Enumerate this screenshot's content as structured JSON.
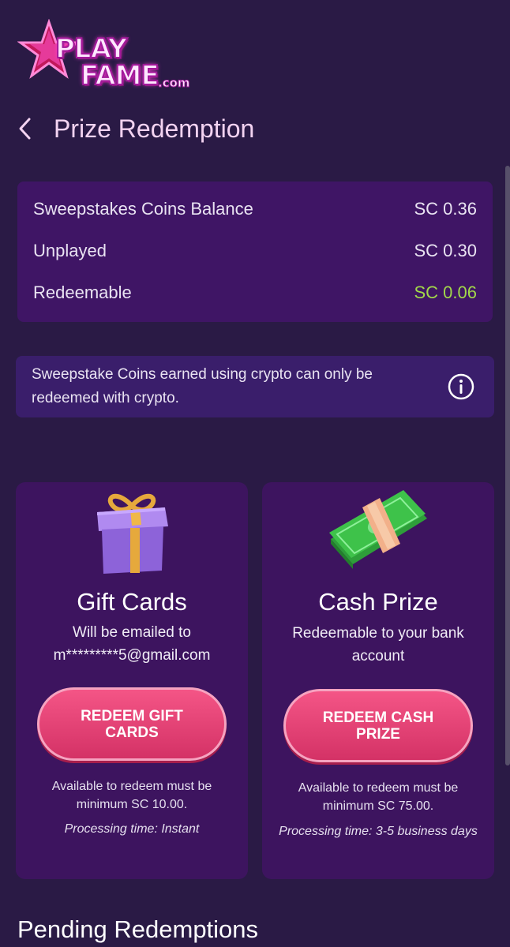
{
  "logo": {
    "line1": "PLAY",
    "line2": "FAME",
    "suffix": ".com"
  },
  "header": {
    "title": "Prize Redemption"
  },
  "balance": {
    "rows": [
      {
        "label": "Sweepstakes Coins Balance",
        "value": "SC 0.36"
      },
      {
        "label": "Unplayed",
        "value": "SC 0.30"
      },
      {
        "label": "Redeemable",
        "value": "SC 0.06"
      }
    ],
    "redeemable_color": "#a2d84a"
  },
  "notice": {
    "text": "Sweepstake Coins earned using crypto can only be redeemed with crypto."
  },
  "gift_cards": {
    "title": "Gift Cards",
    "sub_line1": "Will be emailed to",
    "sub_line2": "m*********5@gmail.com",
    "button": "REDEEM GIFT CARDS",
    "note": "Available to redeem must be minimum SC 10.00.",
    "processing": "Processing time: Instant"
  },
  "cash_prize": {
    "title": "Cash Prize",
    "sub": "Redeemable to your bank account",
    "button": "REDEEM CASH PRIZE",
    "note": "Available to redeem must be minimum SC 75.00.",
    "processing": "Processing time: 3-5 business days"
  },
  "pending": {
    "title": "Pending Redemptions"
  },
  "colors": {
    "background": "#2a1a45",
    "card": "#3d145f",
    "button": "#e8426f",
    "title": "#f3d3f1"
  },
  "icons": {
    "back": "chevron-left-icon",
    "info": "info-icon",
    "gift": "gift-box-icon",
    "cash": "cash-stack-icon"
  }
}
